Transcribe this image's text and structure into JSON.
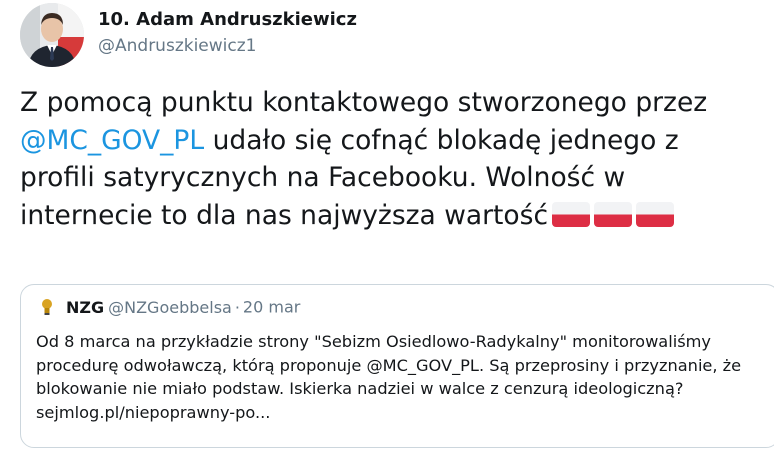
{
  "author": {
    "display_name": "10. Adam Andruszkiewicz",
    "handle": "@Andruszkiewicz1"
  },
  "tweet": {
    "text_before": "Z pomocą punktu kontaktowego stworzonego przez ",
    "mention": "@MC_GOV_PL",
    "text_after": " udało się cofnąć blokadę jednego z profili satyrycznych na Facebooku. Wolność w internecie to dla nas najwyższa wartość",
    "emoji": [
      "flag-poland",
      "flag-poland",
      "flag-poland"
    ]
  },
  "quote": {
    "name": "NZG",
    "handle": "@NZGoebbelsa",
    "separator": "·",
    "time": "20 mar",
    "text": "Od 8 marca na przykładzie strony \"Sebizm Osiedlowo-Radykalny\" monitorowaliśmy procedurę odwoławczą, którą proponuje @MC_GOV_PL. Są przeprosiny i przyznanie, że blokowanie nie miało podstaw. Iskierka nadziei w walce z cenzurą ideologiczną? sejmlog.pl/niepoprawny-po..."
  },
  "colors": {
    "link": "#1b95e0",
    "secondary_text": "#657786",
    "border": "#ccd6dd",
    "flag_red": "#dd2e44",
    "flag_white": "#f2f3f5"
  }
}
